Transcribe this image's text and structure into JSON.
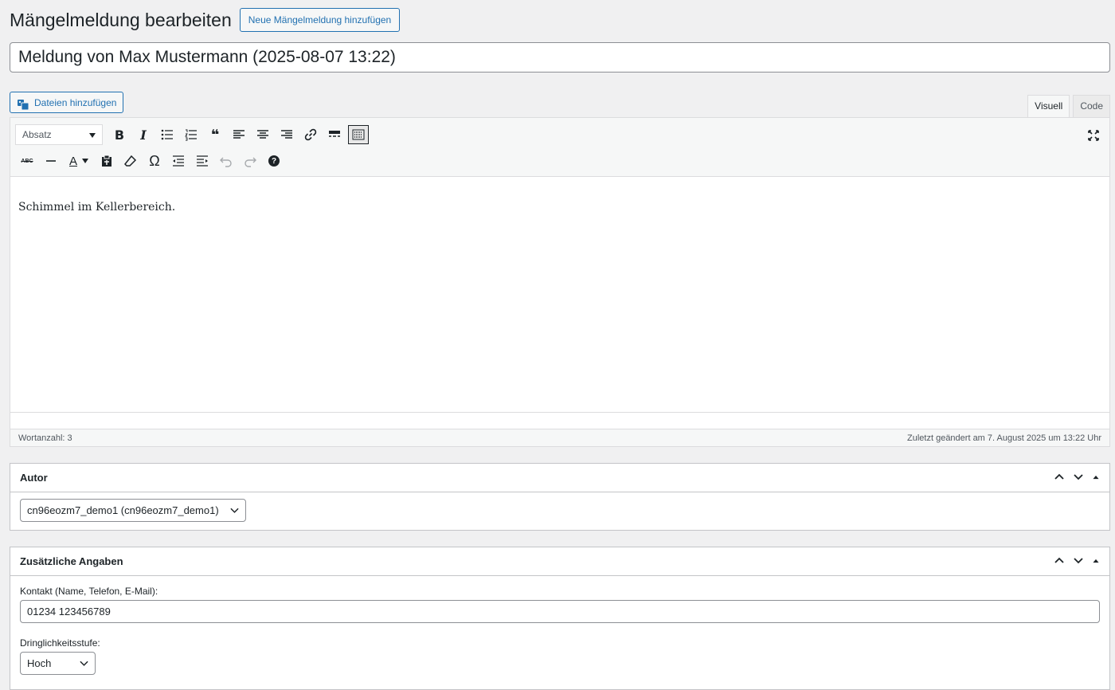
{
  "header": {
    "title": "Mängelmeldung bearbeiten",
    "add_new_label": "Neue Mängelmeldung hinzufügen"
  },
  "post_title": {
    "value": "Meldung von Max Mustermann (2025-08-07 13:22)"
  },
  "media": {
    "add_files_label": "Dateien hinzufügen"
  },
  "editor_tabs": {
    "visual": "Visuell",
    "code": "Code"
  },
  "toolbar": {
    "format_select_value": "Absatz",
    "row1_icons": [
      "bold-icon",
      "italic-icon",
      "bullet-list-icon",
      "numbered-list-icon",
      "blockquote-icon",
      "align-left-icon",
      "align-center-icon",
      "align-right-icon",
      "link-icon",
      "read-more-icon",
      "toolbar-toggle-icon"
    ],
    "row2_icons": [
      "strikethrough-icon",
      "horizontal-line-icon",
      "text-color-icon",
      "paste-text-icon",
      "clear-formatting-icon",
      "special-character-icon",
      "outdent-icon",
      "indent-icon",
      "undo-icon",
      "redo-icon",
      "help-icon"
    ],
    "text_color_letter": "A",
    "strike_label": "ABC",
    "omega": "Ω",
    "quote_glyph": "❝",
    "help_glyph": "?"
  },
  "content": {
    "text": "Schimmel im Kellerbereich."
  },
  "status": {
    "word_count": "Wortanzahl: 3",
    "last_modified": "Zuletzt geändert am 7. August 2025 um 13:22 Uhr"
  },
  "author_box": {
    "title": "Autor",
    "selected": "cn96eozm7_demo1 (cn96eozm7_demo1)"
  },
  "extra_box": {
    "title": "Zusätzliche Angaben",
    "contact_label": "Kontakt (Name, Telefon, E-Mail):",
    "contact_value": "01234 123456789",
    "urgency_label": "Dringlichkeitsstufe:",
    "urgency_value": "Hoch"
  }
}
